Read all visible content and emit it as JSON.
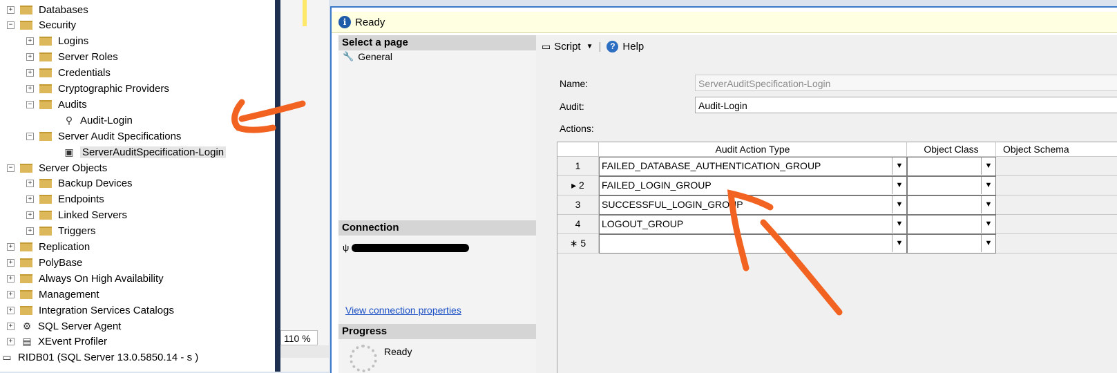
{
  "explorer": {
    "items": [
      {
        "label": "Databases",
        "expander": "+",
        "icon": "folder-icon"
      },
      {
        "label": "Security",
        "expander": "−",
        "icon": "folder-icon"
      },
      {
        "label": "Logins",
        "expander": "+",
        "icon": "folder-icon"
      },
      {
        "label": "Server Roles",
        "expander": "+",
        "icon": "folder-icon"
      },
      {
        "label": "Credentials",
        "expander": "+",
        "icon": "folder-icon"
      },
      {
        "label": "Cryptographic Providers",
        "expander": "+",
        "icon": "folder-icon"
      },
      {
        "label": "Audits",
        "expander": "−",
        "icon": "folder-icon"
      },
      {
        "label": "Audit-Login",
        "expander": "",
        "icon": "audit-icon"
      },
      {
        "label": "Server Audit Specifications",
        "expander": "−",
        "icon": "folder-icon"
      },
      {
        "label": "ServerAuditSpecification-Login",
        "expander": "",
        "icon": "audit-specification-icon"
      },
      {
        "label": "Server Objects",
        "expander": "−",
        "icon": "folder-icon"
      },
      {
        "label": "Backup Devices",
        "expander": "+",
        "icon": "folder-icon"
      },
      {
        "label": "Endpoints",
        "expander": "+",
        "icon": "folder-icon"
      },
      {
        "label": "Linked Servers",
        "expander": "+",
        "icon": "folder-icon"
      },
      {
        "label": "Triggers",
        "expander": "+",
        "icon": "folder-icon"
      },
      {
        "label": "Replication",
        "expander": "+",
        "icon": "folder-icon"
      },
      {
        "label": "PolyBase",
        "expander": "+",
        "icon": "folder-icon"
      },
      {
        "label": "Always On High Availability",
        "expander": "+",
        "icon": "folder-icon"
      },
      {
        "label": "Management",
        "expander": "+",
        "icon": "folder-icon"
      },
      {
        "label": "Integration Services Catalogs",
        "expander": "+",
        "icon": "folder-icon"
      },
      {
        "label": "SQL Server Agent",
        "expander": "+",
        "icon": "sql-agent-icon"
      },
      {
        "label": "XEvent Profiler",
        "expander": "+",
        "icon": "xevent-profiler-icon"
      },
      {
        "label": "RIDB01 (SQL Server 13.0.5850.14 - s )",
        "expander": "",
        "icon": "server-icon"
      }
    ]
  },
  "editor": {
    "zoom": "110 %"
  },
  "dialog": {
    "status": "Ready",
    "select_page_header": "Select a page",
    "pages": [
      {
        "label": "General",
        "icon": "wrench-icon"
      }
    ],
    "connection_header": "Connection",
    "view_connection_link": "View connection properties",
    "progress_header": "Progress",
    "progress_status": "Ready",
    "toolbar": {
      "script_label": "Script",
      "help_label": "Help"
    },
    "form": {
      "name_label": "Name:",
      "name_value": "ServerAuditSpecification-Login",
      "audit_label": "Audit:",
      "audit_value": "Audit-Login",
      "actions_label": "Actions:"
    },
    "grid": {
      "columns": [
        "Audit Action Type",
        "Object Class",
        "Object Schema"
      ],
      "rows": [
        {
          "marker": "1",
          "action": "FAILED_DATABASE_AUTHENTICATION_GROUP",
          "object_class": ""
        },
        {
          "marker": "▸ 2",
          "action": "FAILED_LOGIN_GROUP",
          "object_class": ""
        },
        {
          "marker": "3",
          "action": "SUCCESSFUL_LOGIN_GROUP",
          "object_class": ""
        },
        {
          "marker": "4",
          "action": "LOGOUT_GROUP",
          "object_class": ""
        },
        {
          "marker": "∗ 5",
          "action": "",
          "object_class": ""
        }
      ]
    }
  },
  "colors": {
    "annotation": "#f26322",
    "folder": "#dcb85a",
    "status_bar": "#ffffe1"
  }
}
